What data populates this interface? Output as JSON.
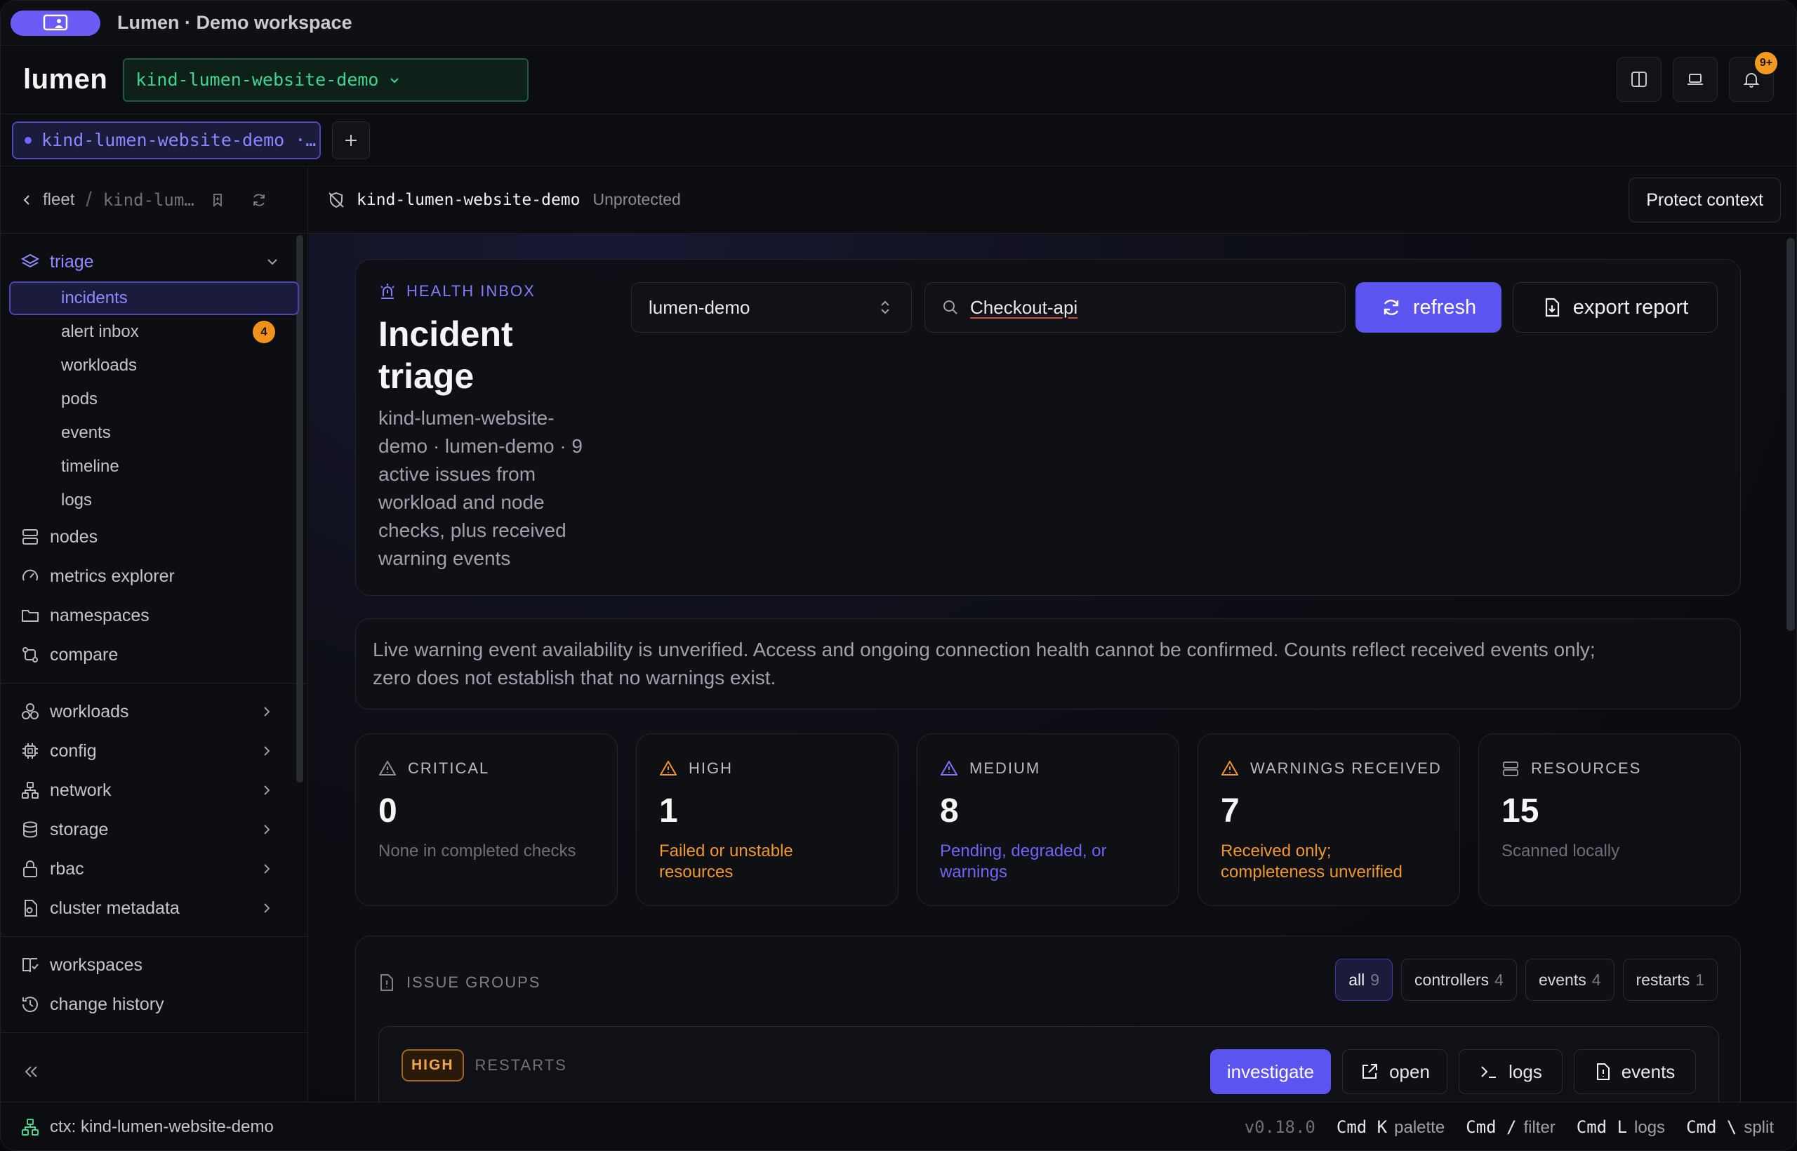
{
  "window": {
    "title": "Lumen · Demo workspace"
  },
  "header": {
    "brand": "lumen",
    "context_select": "kind-lumen-website-demo",
    "notifications_badge": "9+"
  },
  "tabs": {
    "active_tab": "kind-lumen-website-demo ·…"
  },
  "sidebar": {
    "breadcrumb": {
      "root": "fleet",
      "current": "kind-lum…"
    },
    "triage": {
      "label": "triage",
      "items": [
        {
          "label": "incidents"
        },
        {
          "label": "alert inbox",
          "badge": "4"
        },
        {
          "label": "workloads"
        },
        {
          "label": "pods"
        },
        {
          "label": "events"
        },
        {
          "label": "timeline"
        },
        {
          "label": "logs"
        }
      ]
    },
    "top_items": [
      {
        "label": "nodes",
        "icon": "server-icon"
      },
      {
        "label": "metrics explorer",
        "icon": "gauge-icon"
      },
      {
        "label": "namespaces",
        "icon": "folder-icon"
      },
      {
        "label": "compare",
        "icon": "compare-icon"
      }
    ],
    "groups": [
      {
        "label": "workloads",
        "icon": "boxes-icon"
      },
      {
        "label": "config",
        "icon": "cpu-icon"
      },
      {
        "label": "network",
        "icon": "network-icon"
      },
      {
        "label": "storage",
        "icon": "database-icon"
      },
      {
        "label": "rbac",
        "icon": "lock-icon"
      },
      {
        "label": "cluster metadata",
        "icon": "file-settings-icon"
      }
    ],
    "bottom_items": [
      {
        "label": "workspaces",
        "icon": "book-check-icon"
      },
      {
        "label": "change history",
        "icon": "history-icon"
      }
    ]
  },
  "context_bar": {
    "context_name": "kind-lumen-website-demo",
    "protection_state": "Unprotected",
    "protect_button": "Protect context"
  },
  "inbox": {
    "eyebrow": "HEALTH INBOX",
    "title_line1": "Incident",
    "title_line2": "triage",
    "description_lines": [
      "kind-lumen-website-",
      "demo · lumen-demo · 9",
      "active issues from",
      "workload and node",
      "checks, plus received",
      "warning events"
    ],
    "namespace_select": "lumen-demo",
    "search_value": "Checkout-api",
    "refresh_button": "refresh",
    "export_button": "export report"
  },
  "notice": {
    "line1": "Live warning event availability is unverified. Access and ongoing connection health cannot be confirmed. Counts reflect received events only;",
    "line2": "zero does not establish that no warnings exist."
  },
  "stats": [
    {
      "label": "CRITICAL",
      "value": "0",
      "note_lines": [
        "None in completed checks"
      ],
      "note_color": "#6c6f78",
      "icon_color": "#8b8e96"
    },
    {
      "label": "HIGH",
      "value": "1",
      "note_lines": [
        "Failed or unstable",
        "resources"
      ],
      "note_color": "#f0962e",
      "icon_color": "#f0962e"
    },
    {
      "label": "MEDIUM",
      "value": "8",
      "note_lines": [
        "Pending, degraded, or",
        "warnings"
      ],
      "note_color": "#6c66f6",
      "icon_color": "#7a74ff"
    },
    {
      "label": "WARNINGS RECEIVED",
      "value": "7",
      "note_lines": [
        "Received only;",
        "completeness unverified"
      ],
      "note_color": "#f0962e",
      "icon_color": "#f0962e"
    },
    {
      "label": "RESOURCES",
      "value": "15",
      "note_lines": [
        "Scanned locally"
      ],
      "note_color": "#6c6f78",
      "icon_color": "#8b8e96"
    }
  ],
  "issue_groups": {
    "title": "ISSUE GROUPS",
    "filters": [
      {
        "label": "all",
        "count": "9"
      },
      {
        "label": "controllers",
        "count": "4"
      },
      {
        "label": "events",
        "count": "4"
      },
      {
        "label": "restarts",
        "count": "1"
      }
    ],
    "first_issue": {
      "severity": "HIGH",
      "kind": "RESTARTS",
      "actions": [
        "investigate",
        "open",
        "logs",
        "events"
      ]
    }
  },
  "statusbar": {
    "context": "ctx: kind-lumen-website-demo",
    "version": "v0.18.0",
    "shortcuts": [
      {
        "keys": "Cmd K",
        "label": "palette"
      },
      {
        "keys": "Cmd /",
        "label": "filter"
      },
      {
        "keys": "Cmd L",
        "label": "logs"
      },
      {
        "keys": "Cmd \\",
        "label": "split"
      }
    ]
  },
  "colors": {
    "accent": "#5b54f0",
    "context_green": "#40d48f",
    "warning": "#f0962e"
  }
}
